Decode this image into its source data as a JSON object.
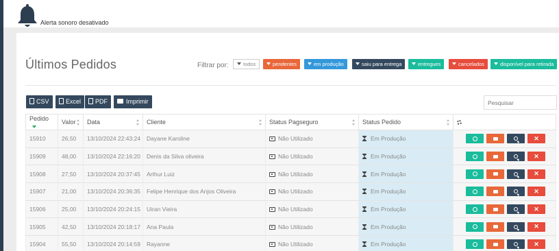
{
  "topbar": {
    "alert_text": "Alerta sonoro desativado"
  },
  "page": {
    "title": "Últimos Pedidos",
    "filter_label": "Filtrar por:",
    "filters": [
      {
        "label": "todos",
        "color": "#ffffff"
      },
      {
        "label": "pendentes",
        "color": "#e8683a"
      },
      {
        "label": "em produção",
        "color": "#3498db"
      },
      {
        "label": "saiu para entrega",
        "color": "#34495e"
      },
      {
        "label": "entregues",
        "color": "#1abc9c"
      },
      {
        "label": "cancelados",
        "color": "#e74c3c"
      },
      {
        "label": "disponível para retirada",
        "color": "#1abc9c"
      }
    ]
  },
  "toolbar": {
    "csv_label": "CSV",
    "excel_label": "Excel",
    "pdf_label": "PDF",
    "print_label": "Imprimir",
    "search_placeholder": "Pesquisar"
  },
  "table": {
    "headers": [
      "Pedido",
      "Valor",
      "Data",
      "Cliente",
      "Status Pagseguro",
      "Status Pedido"
    ],
    "rows": [
      {
        "pedido": "15910",
        "valor": "26,50",
        "data": "13/10/2024 22:43:24",
        "cliente": "Dayane Karoline",
        "pagseguro": "Não Utilizado",
        "status": "Em Produção"
      },
      {
        "pedido": "15909",
        "valor": "48,00",
        "data": "13/10/2024 22:16:20",
        "cliente": "Denis da Silva oliveira",
        "pagseguro": "Não Utilizado",
        "status": "Em Produção"
      },
      {
        "pedido": "15908",
        "valor": "27,50",
        "data": "13/10/2024 20:37:45",
        "cliente": "Arthur Luiz",
        "pagseguro": "Não Utilizado",
        "status": "Em Produção"
      },
      {
        "pedido": "15907",
        "valor": "21,00",
        "data": "13/10/2024 20:36:35",
        "cliente": "Felipe Henrique dos Anjos Oliveira",
        "pagseguro": "Não Utilizado",
        "status": "Em Produção"
      },
      {
        "pedido": "15906",
        "valor": "25,00",
        "data": "13/10/2024 20:24:15",
        "cliente": "Uiran Vieira",
        "pagseguro": "Não Utilizado",
        "status": "Em Produção"
      },
      {
        "pedido": "15905",
        "valor": "42,50",
        "data": "13/10/2024 20:18:17",
        "cliente": "Ana Paula",
        "pagseguro": "Não Utilizado",
        "status": "Em Produção"
      },
      {
        "pedido": "15904",
        "valor": "55,50",
        "data": "13/10/2024 20:14:59",
        "cliente": "Rayanne",
        "pagseguro": "Não Utilizado",
        "status": "Em Produção"
      }
    ]
  },
  "colors": {
    "whatsapp": "#1abc9c",
    "print": "#e8683a",
    "view": "#34495e",
    "remove": "#e74c3c",
    "status_highlight": "#d9ecf5"
  },
  "icons": {
    "row_actions": [
      "whatsapp-icon",
      "print-icon",
      "search-icon",
      "close-icon"
    ],
    "settings": "gear-icon",
    "alert": "bell-icon"
  }
}
